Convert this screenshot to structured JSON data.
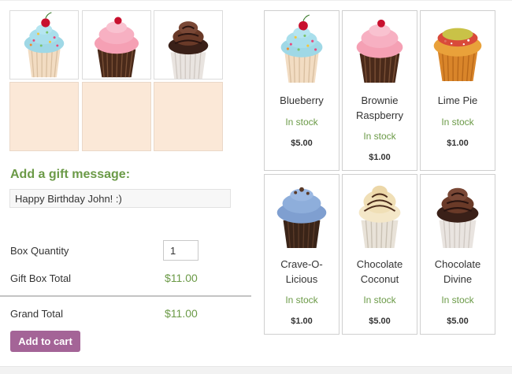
{
  "box": {
    "slots": [
      {
        "filled": true,
        "image": "blueberry-cupcake-image"
      },
      {
        "filled": true,
        "image": "brownie-raspberry-cupcake-image"
      },
      {
        "filled": true,
        "image": "chocolate-divine-cupcake-image"
      },
      {
        "filled": false
      },
      {
        "filled": false
      },
      {
        "filled": false
      }
    ]
  },
  "gift": {
    "title": "Add a gift message:",
    "message": "Happy Birthday John! :)"
  },
  "totals": {
    "box_quantity_label": "Box Quantity",
    "box_quantity_value": "1",
    "gift_box_total_label": "Gift Box Total",
    "gift_box_total_value": "$11.00",
    "grand_total_label": "Grand Total",
    "grand_total_value": "$11.00"
  },
  "actions": {
    "add_to_cart_label": "Add to cart"
  },
  "products": [
    {
      "name_lines": [
        "Blueberry"
      ],
      "stock": "In stock",
      "price": "$5.00",
      "image": "blueberry-cupcake-image"
    },
    {
      "name_lines": [
        "Brownie",
        "Raspberry"
      ],
      "stock": "In stock",
      "price": "$1.00",
      "image": "brownie-raspberry-cupcake-image"
    },
    {
      "name_lines": [
        "Lime Pie"
      ],
      "stock": "In stock",
      "price": "$1.00",
      "image": "lime-pie-cupcake-image"
    },
    {
      "name_lines": [
        "Crave-O-",
        "Licious"
      ],
      "stock": "In stock",
      "price": "$1.00",
      "image": "crave-o-licious-cupcake-image"
    },
    {
      "name_lines": [
        "Chocolate",
        "Coconut"
      ],
      "stock": "In stock",
      "price": "$5.00",
      "image": "chocolate-coconut-cupcake-image"
    },
    {
      "name_lines": [
        "Chocolate",
        "Divine"
      ],
      "stock": "In stock",
      "price": "$5.00",
      "image": "chocolate-divine-cupcake-image"
    }
  ],
  "colors": {
    "accent_green": "#6b9a47",
    "button_purple": "#a46497",
    "empty_slot": "#fbe8d7"
  }
}
